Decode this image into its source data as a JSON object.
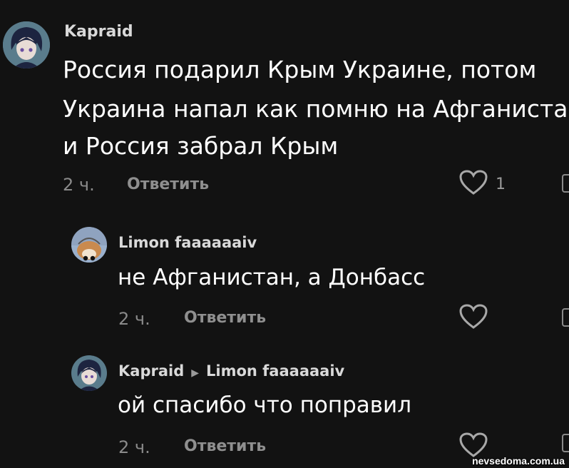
{
  "comments": [
    {
      "username": "Kapraid",
      "lines": [
        "Россия подарил Крым Украине, потом",
        "Украина напал как помню на Афганиста",
        "и Россия забрал Крым"
      ],
      "time": "2 ч.",
      "reply_label": "Ответить",
      "like_count": "1"
    },
    {
      "username": "Limon faaaaaaiv",
      "text": "не Афганистан, а Донбасс",
      "time": "2 ч.",
      "reply_label": "Ответить"
    },
    {
      "username": "Kapraid",
      "reply_to": "Limon faaaaaaiv",
      "text": "ой спасибо что поправил",
      "time": "2 ч.",
      "reply_label": "Ответить"
    }
  ],
  "watermark": "nevsedoma.com.ua",
  "colors": {
    "background": "#121212",
    "text": "#ffffff",
    "muted": "#8a8a8a"
  }
}
